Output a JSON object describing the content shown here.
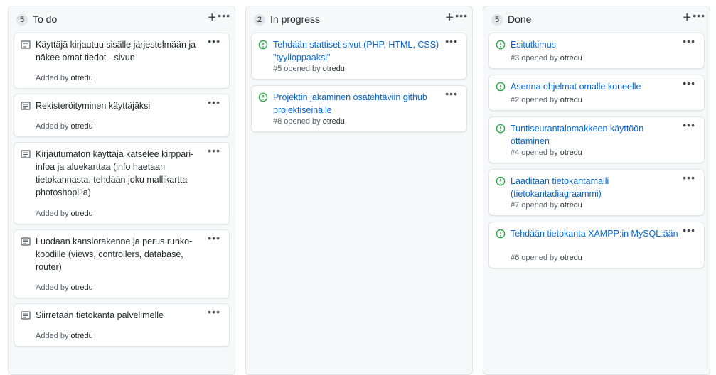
{
  "columns": [
    {
      "count": "5",
      "title": "To do",
      "cards": [
        {
          "title": "Käyttäjä kirjautuu sisälle järjestelmään ja näkee omat tiedot - sivun",
          "added_by": "Added by",
          "user": "otredu"
        },
        {
          "title": "Rekisteröityminen käyttäjäksi",
          "added_by": "Added by",
          "user": "otredu"
        },
        {
          "title": "Kirjautumaton käyttäjä katselee kirppari-infoa ja aluekarttaa (info haetaan tietokannasta, tehdään joku mallikartta photoshopilla)",
          "added_by": "Added by",
          "user": "otredu"
        },
        {
          "title": "Luodaan kansiorakenne ja perus runko-koodille (views, controllers, database, router)",
          "added_by": "Added by",
          "user": "otredu"
        },
        {
          "title": "Siirretään tietokanta palvelimelle",
          "added_by": "Added by",
          "user": "otredu"
        }
      ]
    },
    {
      "count": "2",
      "title": "In progress",
      "cards": [
        {
          "title": "Tehdään stattiset sivut (PHP, HTML, CSS) \"tyylioppaaksi\"",
          "meta": "#5 opened by",
          "user": "otredu"
        },
        {
          "title": "Projektin jakaminen osatehtäviin github projektiseinälle",
          "meta": "#8 opened by",
          "user": "otredu"
        }
      ]
    },
    {
      "count": "5",
      "title": "Done",
      "cards": [
        {
          "title": "Esitutkimus",
          "meta": "#3 opened by",
          "user": "otredu"
        },
        {
          "title": "Asenna ohjelmat omalle koneelle",
          "meta": "#2 opened by",
          "user": "otredu"
        },
        {
          "title": "Tuntiseurantalomakkeen käyttöön ottaminen",
          "meta": "#4 opened by",
          "user": "otredu"
        },
        {
          "title": "Laaditaan tietokantamalli (tietokantadiagraammi)",
          "meta": "#7 opened by",
          "user": "otredu"
        },
        {
          "title": "Tehdään tietokanta XAMPP:in MySQL:ään",
          "meta": "#6 opened by",
          "user": "otredu"
        }
      ]
    }
  ],
  "icons": {
    "add": "+",
    "menu": "•••",
    "note": "note-icon",
    "issue": "issue-opened-icon"
  },
  "colors": {
    "issue_icon": "#28a745",
    "link": "#0366d6",
    "column_bg": "#f6f8fa"
  }
}
